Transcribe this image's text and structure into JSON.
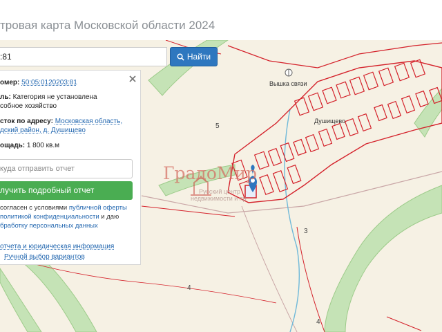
{
  "page": {
    "title": "тровая карта Московской области 2024"
  },
  "search": {
    "value": ":81",
    "button_label": "Найти"
  },
  "panel": {
    "cadastral_label": "омер:",
    "cadastral_value": "50:05:0120203:81",
    "category_label": "ль:",
    "category_value": "Категория не установлена",
    "category_value_2": "собное хозяйство",
    "address_label": "сток по адресу:",
    "address_value": "Московская область,",
    "address_value_2": "дский район, д. Душищево",
    "area_label": "ощадь:",
    "area_value": "1 800 кв.м",
    "email_placeholder": "куда отправить отчет",
    "report_button": "лучить подробный отчет",
    "consent_1a": "согласен с условиями ",
    "consent_1b": "публичной оферты",
    "consent_2a": "политикой конфиденциальности",
    "consent_2b": " и даю",
    "consent_3": "бработку персональных данных",
    "footer_link_1": "отчета и юридическая информация",
    "footer_link_2": "Ручной выбор вариантов"
  },
  "map": {
    "label_tower": "Вышка связи",
    "label_village": "Душищево",
    "num_5": "5",
    "num_3": "3",
    "num_4a": "4",
    "num_4b": "4"
  },
  "watermark": {
    "brand": "ГрадоМир",
    "line1": "Русский центр",
    "line2": "недвижимости и пр"
  },
  "colors": {
    "accent": "#2e77bf",
    "success": "#4aad52",
    "parcel": "#d4212a",
    "green_belt": "#b7dba8",
    "map_bg": "#f6f1e4"
  }
}
